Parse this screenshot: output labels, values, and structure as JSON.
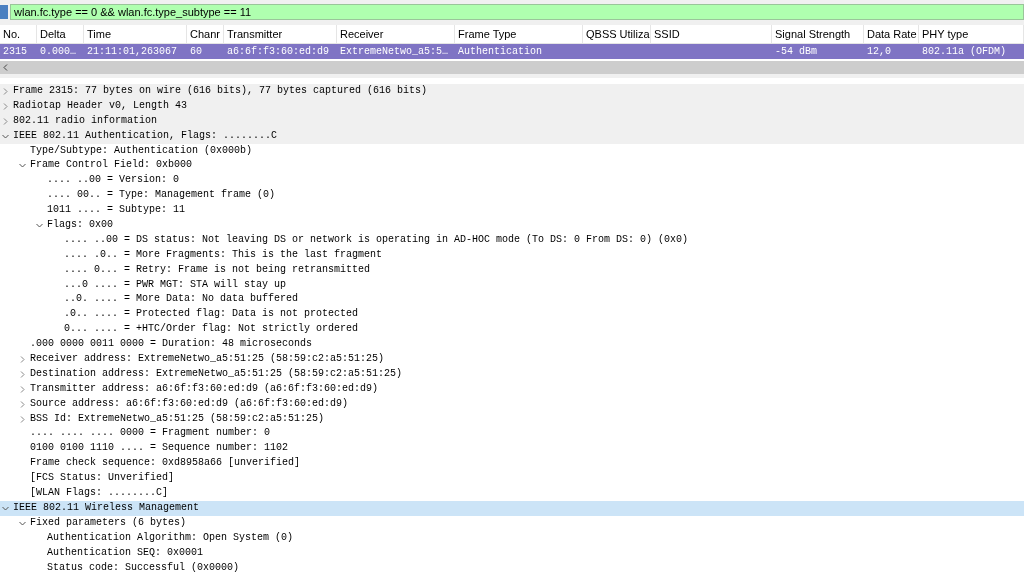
{
  "filter": {
    "value": "wlan.fc.type == 0 && wlan.fc.type_subtype == 11"
  },
  "packet_list": {
    "columns": [
      "No.",
      "Delta",
      "Time",
      "Chanr",
      "Transmitter",
      "Receiver",
      "Frame Type",
      "QBSS Utiliza",
      "SSID",
      "Signal Strength",
      "Data Rate",
      "PHY type"
    ],
    "rows": [
      {
        "selected": true,
        "cells": [
          "2315",
          "0.000…",
          "21:11:01,263067",
          "60",
          "a6:6f:f3:60:ed:d9",
          "ExtremeNetwo_a5:5…",
          "Authentication",
          "",
          "",
          "-54 dBm",
          "12,0",
          "802.11a (OFDM)"
        ]
      }
    ]
  },
  "details": [
    {
      "text": "Frame 2315: 77 bytes on wire (616 bits), 77 bytes captured (616 bits)",
      "expanded": false,
      "selected": false
    },
    {
      "text": "Radiotap Header v0, Length 43",
      "expanded": false,
      "selected": false
    },
    {
      "text": "802.11 radio information",
      "expanded": false,
      "selected": false
    },
    {
      "text": "IEEE 802.11 Authentication, Flags: ........C",
      "expanded": true,
      "selected": false,
      "children": [
        {
          "text": "Type/Subtype: Authentication (0x000b)",
          "selected": false
        },
        {
          "text": "Frame Control Field: 0xb000",
          "expanded": true,
          "selected": false,
          "children": [
            {
              "text": ".... ..00 = Version: 0",
              "selected": false
            },
            {
              "text": ".... 00.. = Type: Management frame (0)",
              "selected": false
            },
            {
              "text": "1011 .... = Subtype: 11",
              "selected": false
            },
            {
              "text": "Flags: 0x00",
              "expanded": true,
              "selected": false,
              "children": [
                {
                  "text": ".... ..00 = DS status: Not leaving DS or network is operating in AD-HOC mode (To DS: 0 From DS: 0) (0x0)",
                  "selected": false
                },
                {
                  "text": ".... .0.. = More Fragments: This is the last fragment",
                  "selected": false
                },
                {
                  "text": ".... 0... = Retry: Frame is not being retransmitted",
                  "selected": false
                },
                {
                  "text": "...0 .... = PWR MGT: STA will stay up",
                  "selected": false
                },
                {
                  "text": "..0. .... = More Data: No data buffered",
                  "selected": false
                },
                {
                  "text": ".0.. .... = Protected flag: Data is not protected",
                  "selected": false
                },
                {
                  "text": "0... .... = +HTC/Order flag: Not strictly ordered",
                  "selected": false
                }
              ]
            }
          ]
        },
        {
          "text": ".000 0000 0011 0000 = Duration: 48 microseconds",
          "selected": false
        },
        {
          "text": "Receiver address: ExtremeNetwo_a5:51:25 (58:59:c2:a5:51:25)",
          "expanded": false,
          "selected": false
        },
        {
          "text": "Destination address: ExtremeNetwo_a5:51:25 (58:59:c2:a5:51:25)",
          "expanded": false,
          "selected": false
        },
        {
          "text": "Transmitter address: a6:6f:f3:60:ed:d9 (a6:6f:f3:60:ed:d9)",
          "expanded": false,
          "selected": false
        },
        {
          "text": "Source address: a6:6f:f3:60:ed:d9 (a6:6f:f3:60:ed:d9)",
          "expanded": false,
          "selected": false
        },
        {
          "text": "BSS Id: ExtremeNetwo_a5:51:25 (58:59:c2:a5:51:25)",
          "expanded": false,
          "selected": false
        },
        {
          "text": ".... .... .... 0000 = Fragment number: 0",
          "selected": false
        },
        {
          "text": "0100 0100 1110 .... = Sequence number: 1102",
          "selected": false
        },
        {
          "text": "Frame check sequence: 0xd8958a66 [unverified]",
          "selected": false
        },
        {
          "text": "[FCS Status: Unverified]",
          "selected": false
        },
        {
          "text": "[WLAN Flags: ........C]",
          "selected": false
        }
      ]
    },
    {
      "text": "IEEE 802.11 Wireless Management",
      "expanded": true,
      "selected": true,
      "children": [
        {
          "text": "Fixed parameters (6 bytes)",
          "expanded": true,
          "selected": false,
          "children": [
            {
              "text": "Authentication Algorithm: Open System (0)",
              "selected": false
            },
            {
              "text": "Authentication SEQ: 0x0001",
              "selected": false
            },
            {
              "text": "Status code: Successful (0x0000)",
              "selected": false
            }
          ]
        }
      ]
    }
  ]
}
